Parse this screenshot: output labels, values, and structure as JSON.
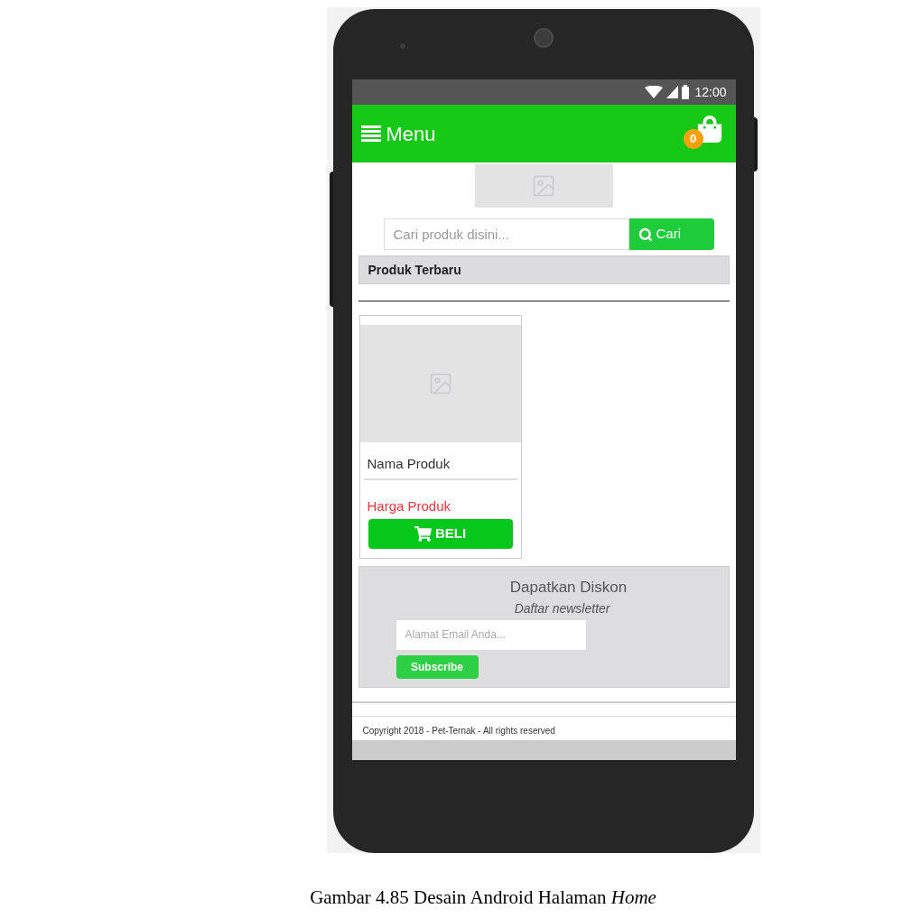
{
  "status_bar": {
    "time": "12:00"
  },
  "header": {
    "title": "Menu",
    "cart_count": "0"
  },
  "search": {
    "placeholder": "Cari produk disini...",
    "button": "Cari"
  },
  "section": {
    "title": "Produk Terbaru"
  },
  "products": [
    {
      "name": "Nama Produk",
      "price": "Harga Produk",
      "button": "BELI"
    }
  ],
  "newsletter": {
    "title": "Dapatkan Diskon",
    "subtitle": "Daftar newsletter",
    "placeholder": "Alamat Email Anda...",
    "button": "Subscribe"
  },
  "footer": {
    "copyright": "Copyright 2018 - Pet-Ternak - All rights reserved"
  },
  "caption": "Gambar 4.85 Desain Android Halaman *Home*"
}
